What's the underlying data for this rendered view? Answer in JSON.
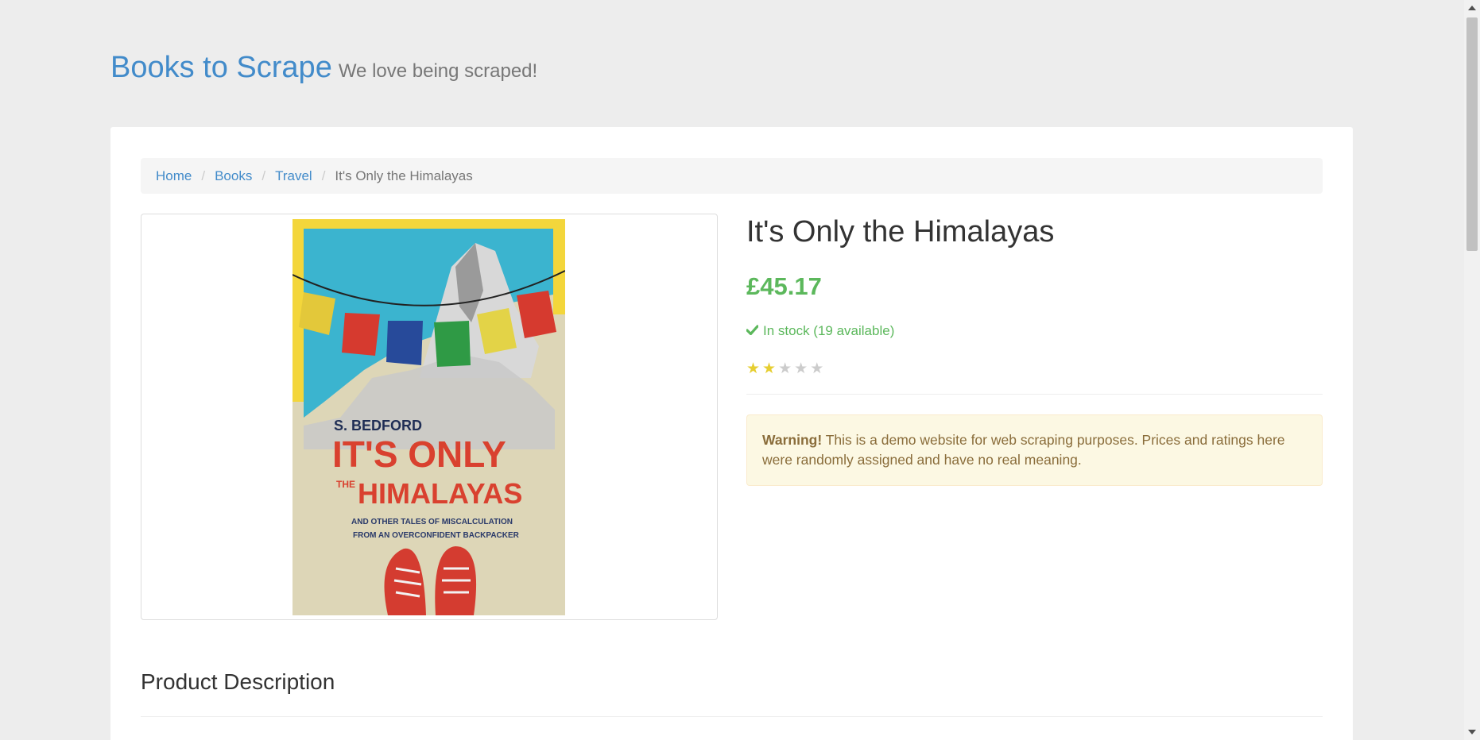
{
  "header": {
    "brand": "Books to Scrape",
    "tagline": "We love being scraped!"
  },
  "breadcrumb": {
    "items": [
      "Home",
      "Books",
      "Travel"
    ],
    "separator": "/",
    "current": "It's Only the Himalayas"
  },
  "book_cover": {
    "author": "S. BEDFORD",
    "title_line1": "IT'S ONLY",
    "title_the": "THE",
    "title_line2": "HIMALAYAS",
    "subtitle_line1": "AND OTHER TALES OF MISCALCULATION",
    "subtitle_line2": "FROM AN OVERCONFIDENT BACKPACKER"
  },
  "product": {
    "title": "It's Only the Himalayas",
    "price": "£45.17",
    "stock": "In stock (19 available)",
    "rating": 2,
    "rating_max": 5
  },
  "alert": {
    "label": "Warning!",
    "text": " This is a demo website for web scraping purposes. Prices and ratings here were randomly assigned and have no real meaning."
  },
  "description": {
    "heading": "Product Description"
  },
  "colors": {
    "link": "#428bca",
    "price": "#5cb85c",
    "star_on": "#e6ce31",
    "star_off": "#cccccc",
    "alert_bg": "#fcf8e3"
  },
  "icons": {
    "stock": "check-icon",
    "rating": "star-icon"
  }
}
